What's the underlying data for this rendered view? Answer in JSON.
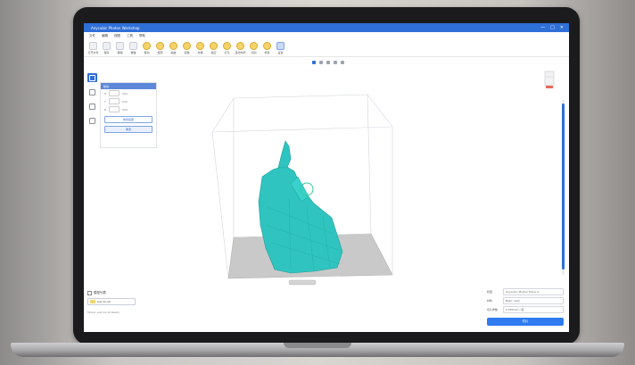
{
  "window": {
    "title": "Anycubic Photon Workshop",
    "controls": [
      "—",
      "□",
      "✕"
    ]
  },
  "menu": [
    "文件",
    "编辑",
    "视图",
    "工具",
    "帮助"
  ],
  "toolbar": [
    {
      "label": "打开文件",
      "icon": "folder-open-icon",
      "style": "plain"
    },
    {
      "label": "保存",
      "icon": "save-icon",
      "style": "plain"
    },
    {
      "label": "撤销",
      "icon": "undo-icon",
      "style": "plain"
    },
    {
      "label": "重做",
      "icon": "redo-icon",
      "style": "plain"
    },
    {
      "label": "移动",
      "icon": "move-icon",
      "style": "warm"
    },
    {
      "label": "旋转",
      "icon": "rotate-icon",
      "style": "warm"
    },
    {
      "label": "缩放",
      "icon": "scale-icon",
      "style": "warm"
    },
    {
      "label": "镜像",
      "icon": "mirror-icon",
      "style": "warm"
    },
    {
      "label": "支撑",
      "icon": "support-icon",
      "style": "warm"
    },
    {
      "label": "抽空",
      "icon": "hollow-icon",
      "style": "warm"
    },
    {
      "label": "打孔",
      "icon": "punch-icon",
      "style": "warm"
    },
    {
      "label": "自动布局",
      "icon": "auto-layout-icon",
      "style": "warm"
    },
    {
      "label": "切割",
      "icon": "cut-icon",
      "style": "warm"
    },
    {
      "label": "修复",
      "icon": "repair-icon",
      "style": "warm"
    },
    {
      "label": "设置",
      "icon": "settings-icon",
      "style": "blue"
    }
  ],
  "left_rail": [
    {
      "icon": "move-icon",
      "active": true
    },
    {
      "icon": "rotate-icon",
      "active": false
    },
    {
      "icon": "scale-icon",
      "active": false
    },
    {
      "icon": "mirror-icon",
      "active": false
    }
  ],
  "transform_panel": {
    "header": "移动",
    "rows": [
      {
        "axis": "X",
        "value": "",
        "unit": "mm"
      },
      {
        "axis": "Y",
        "value": "",
        "unit": "mm"
      },
      {
        "axis": "Z",
        "value": "",
        "unit": "mm"
      }
    ],
    "button_primary": "放到底部",
    "button_secondary": "重置"
  },
  "view_buttons": [
    "persp",
    "front",
    "side",
    "top",
    "fit"
  ],
  "bottom_left": {
    "label": "模型列表",
    "selected_model": "warrior.stl",
    "status": "Model: warrior.stl  Ready"
  },
  "right_settings": {
    "rows": [
      {
        "key": "机型",
        "value": "Anycubic Photon Mono X"
      },
      {
        "key": "材料",
        "value": "Basic resin"
      },
      {
        "key": "切片参数",
        "value": "0.050mm / 层"
      }
    ],
    "slice_button": "切片"
  },
  "colors": {
    "accent": "#2f6fd8",
    "model": "#2fc4bf",
    "plate": "#bdbdbd"
  }
}
